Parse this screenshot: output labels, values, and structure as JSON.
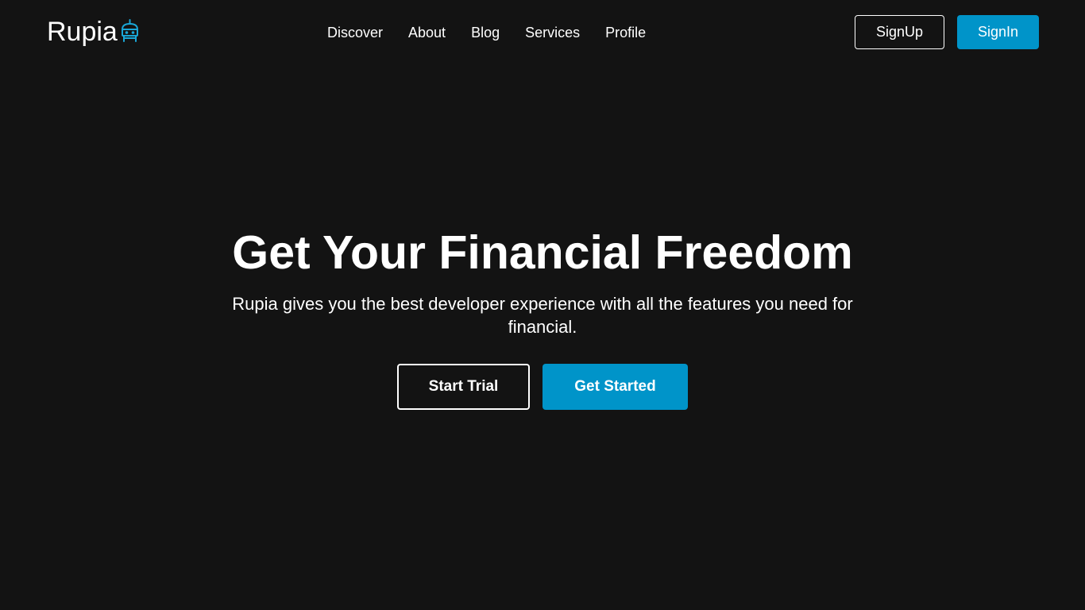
{
  "header": {
    "logo_text": "Rupia",
    "logo_icon": "robot-icon",
    "nav": [
      {
        "label": "Discover"
      },
      {
        "label": "About"
      },
      {
        "label": "Blog"
      },
      {
        "label": "Services"
      },
      {
        "label": "Profile"
      }
    ],
    "signup_label": "SignUp",
    "signin_label": "SignIn"
  },
  "hero": {
    "title": "Get Your Financial Freedom",
    "subtitle": "Rupia gives you the best developer experience with all the features you need for financial.",
    "start_trial_label": "Start Trial",
    "get_started_label": "Get Started"
  },
  "colors": {
    "background": "#131313",
    "accent": "#0094c9",
    "text": "#ffffff"
  }
}
